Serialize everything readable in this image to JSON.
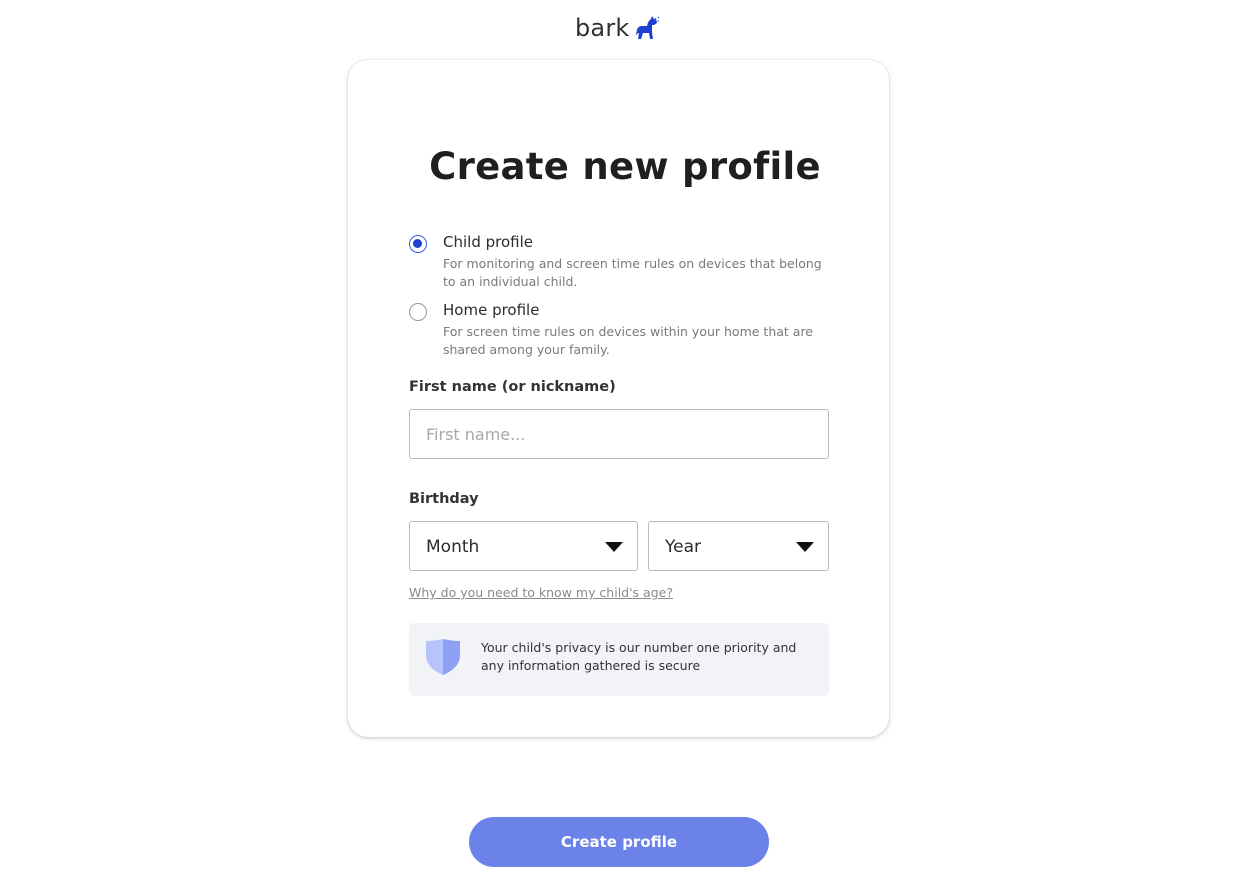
{
  "brand": {
    "name": "bark",
    "logo_icon": "dog-icon",
    "accent": "#1f3fcf"
  },
  "page": {
    "title": "Create new profile"
  },
  "profile_types": [
    {
      "label": "Child profile",
      "description": "For monitoring and screen time rules on devices that belong to an individual child.",
      "selected": true
    },
    {
      "label": "Home profile",
      "description": "For screen time rules on devices within your home that are shared among your family.",
      "selected": false
    }
  ],
  "first_name": {
    "label": "First name (or nickname)",
    "placeholder": "First name...",
    "value": ""
  },
  "birthday": {
    "label": "Birthday",
    "month": {
      "selected": "Month"
    },
    "year": {
      "selected": "Year"
    },
    "why_link": "Why do you need to know my child's age?"
  },
  "privacy_note": {
    "icon": "shield-icon",
    "text": "Your child's privacy is our number one priority and any information gathered is secure"
  },
  "cta": {
    "label": "Create profile",
    "color": "#6b82e8"
  }
}
